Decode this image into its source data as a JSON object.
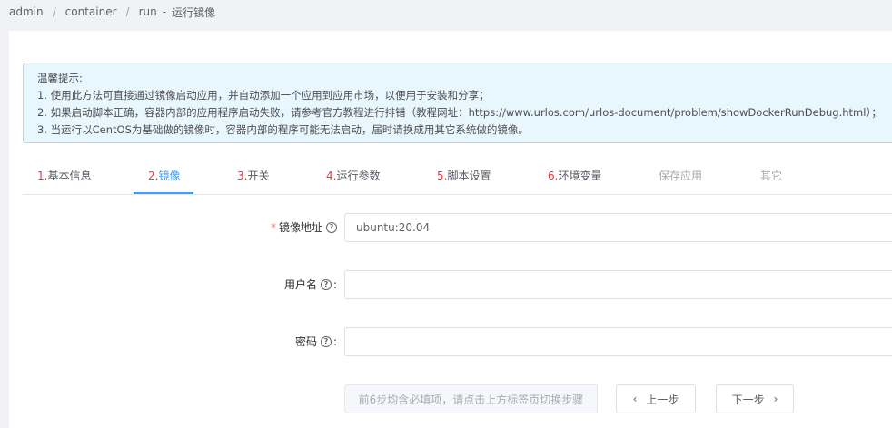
{
  "breadcrumb": {
    "items": [
      "admin",
      "container",
      "run"
    ],
    "separator": "/",
    "dash": "-",
    "current": "运行镜像"
  },
  "alert": {
    "title": "温馨提示:",
    "lines": [
      "1. 使用此方法可直接通过镜像启动应用，并自动添加一个应用到应用市场，以便用于安装和分享；",
      "2. 如果启动脚本正确，容器内部的应用程序启动失败，请参考官方教程进行排错（教程网址：https://www.urlos.com/urlos-document/problem/showDockerRunDebug.html）；",
      "3. 当运行以CentOS为基础做的镜像时，容器内部的程序可能无法启动，届时请换成用其它系统做的镜像。"
    ]
  },
  "tabs": [
    {
      "num": "1.",
      "label": "基本信息",
      "state": "normal"
    },
    {
      "num": "2.",
      "label": "镜像",
      "state": "active"
    },
    {
      "num": "3.",
      "label": "开关",
      "state": "normal"
    },
    {
      "num": "4.",
      "label": "运行参数",
      "state": "normal"
    },
    {
      "num": "5.",
      "label": "脚本设置",
      "state": "normal"
    },
    {
      "num": "6.",
      "label": "环境变量",
      "state": "normal"
    },
    {
      "num": "",
      "label": "保存应用",
      "state": "disabled"
    },
    {
      "num": "",
      "label": "其它",
      "state": "disabled"
    }
  ],
  "form": {
    "image": {
      "required_mark": "*",
      "label": "镜像地址",
      "help": "?",
      "value": "ubuntu:20.04"
    },
    "username": {
      "label": "用户名",
      "help": "?",
      "colon": ":",
      "value": ""
    },
    "password": {
      "label": "密码",
      "help": "?",
      "colon": ":",
      "value": ""
    }
  },
  "buttons": {
    "hint": "前6步均含必填项，请点击上方标签页切换步骤",
    "prev_icon": "‹",
    "prev": "上一步",
    "next": "下一步",
    "next_icon": "›"
  },
  "colors": {
    "accent": "#409eff",
    "step_number": "#e8383d",
    "alert_bg": "#e8f6fd",
    "alert_border": "#a6dcf5"
  }
}
